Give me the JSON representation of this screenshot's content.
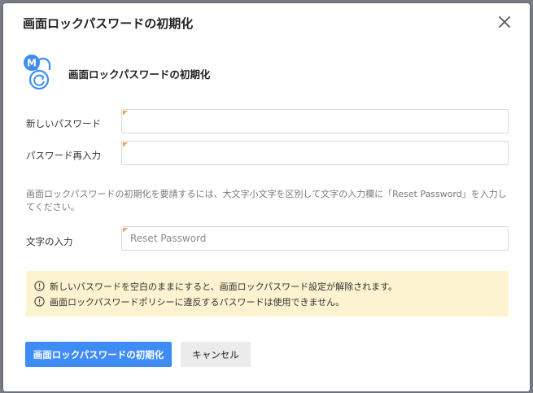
{
  "dialog": {
    "title": "画面ロックパスワードの初期化",
    "close_icon": "close-icon"
  },
  "header": {
    "icon": "lock-reset-icon",
    "badge_letter": "M",
    "title": "画面ロックパスワードの初期化"
  },
  "form": {
    "new_password": {
      "label": "新しいパスワード",
      "value": ""
    },
    "confirm_password": {
      "label": "パスワード再入力",
      "value": ""
    },
    "description": "画面ロックパスワードの初期化を要請するには、大文字小文字を区別して文字の入力欄に「Reset Password」を入力してください。",
    "phrase": {
      "label": "文字の入力",
      "placeholder": "Reset Password"
    }
  },
  "notices": [
    "新しいパスワードを空白のままにすると、画面ロックパスワード設定が解除されます。",
    "画面ロックパスワードポリシーに違反するパスワードは使用できません。"
  ],
  "buttons": {
    "submit": "画面ロックパスワードの初期化",
    "cancel": "キャンセル"
  },
  "colors": {
    "primary": "#3f8cf6",
    "notice_bg": "#fdf3d0",
    "badge": "#3f8cf6"
  }
}
